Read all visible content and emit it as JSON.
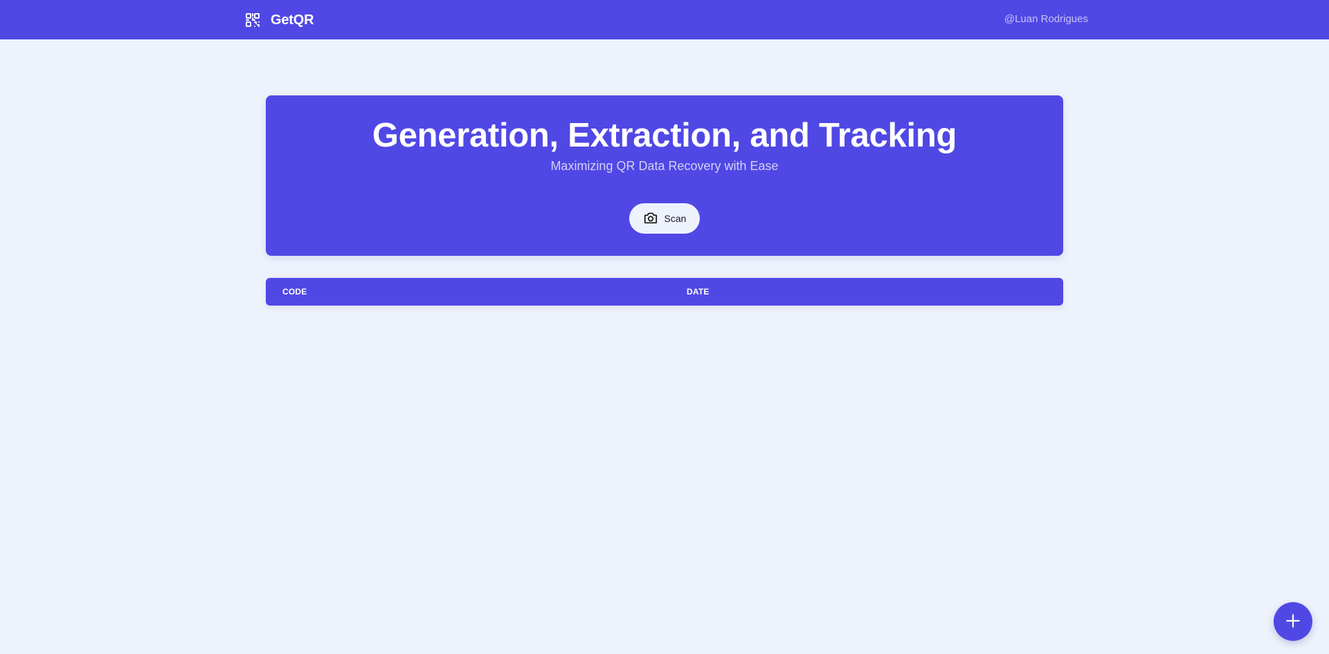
{
  "header": {
    "brand_name": "GetQR",
    "author": "@Luan Rodrigues",
    "brand_icon": "qr-code-icon"
  },
  "hero": {
    "title": "Generation, Extraction, and Tracking",
    "subtitle": "Maximizing QR Data Recovery with Ease",
    "scan_label": "Scan",
    "scan_icon": "camera-icon"
  },
  "table": {
    "columns": [
      "CODE",
      "DATE"
    ],
    "rows": []
  },
  "fab": {
    "icon": "plus-icon"
  },
  "colors": {
    "primary": "#5048e5",
    "background": "#eef2fc",
    "text_light": "#ffffff"
  }
}
